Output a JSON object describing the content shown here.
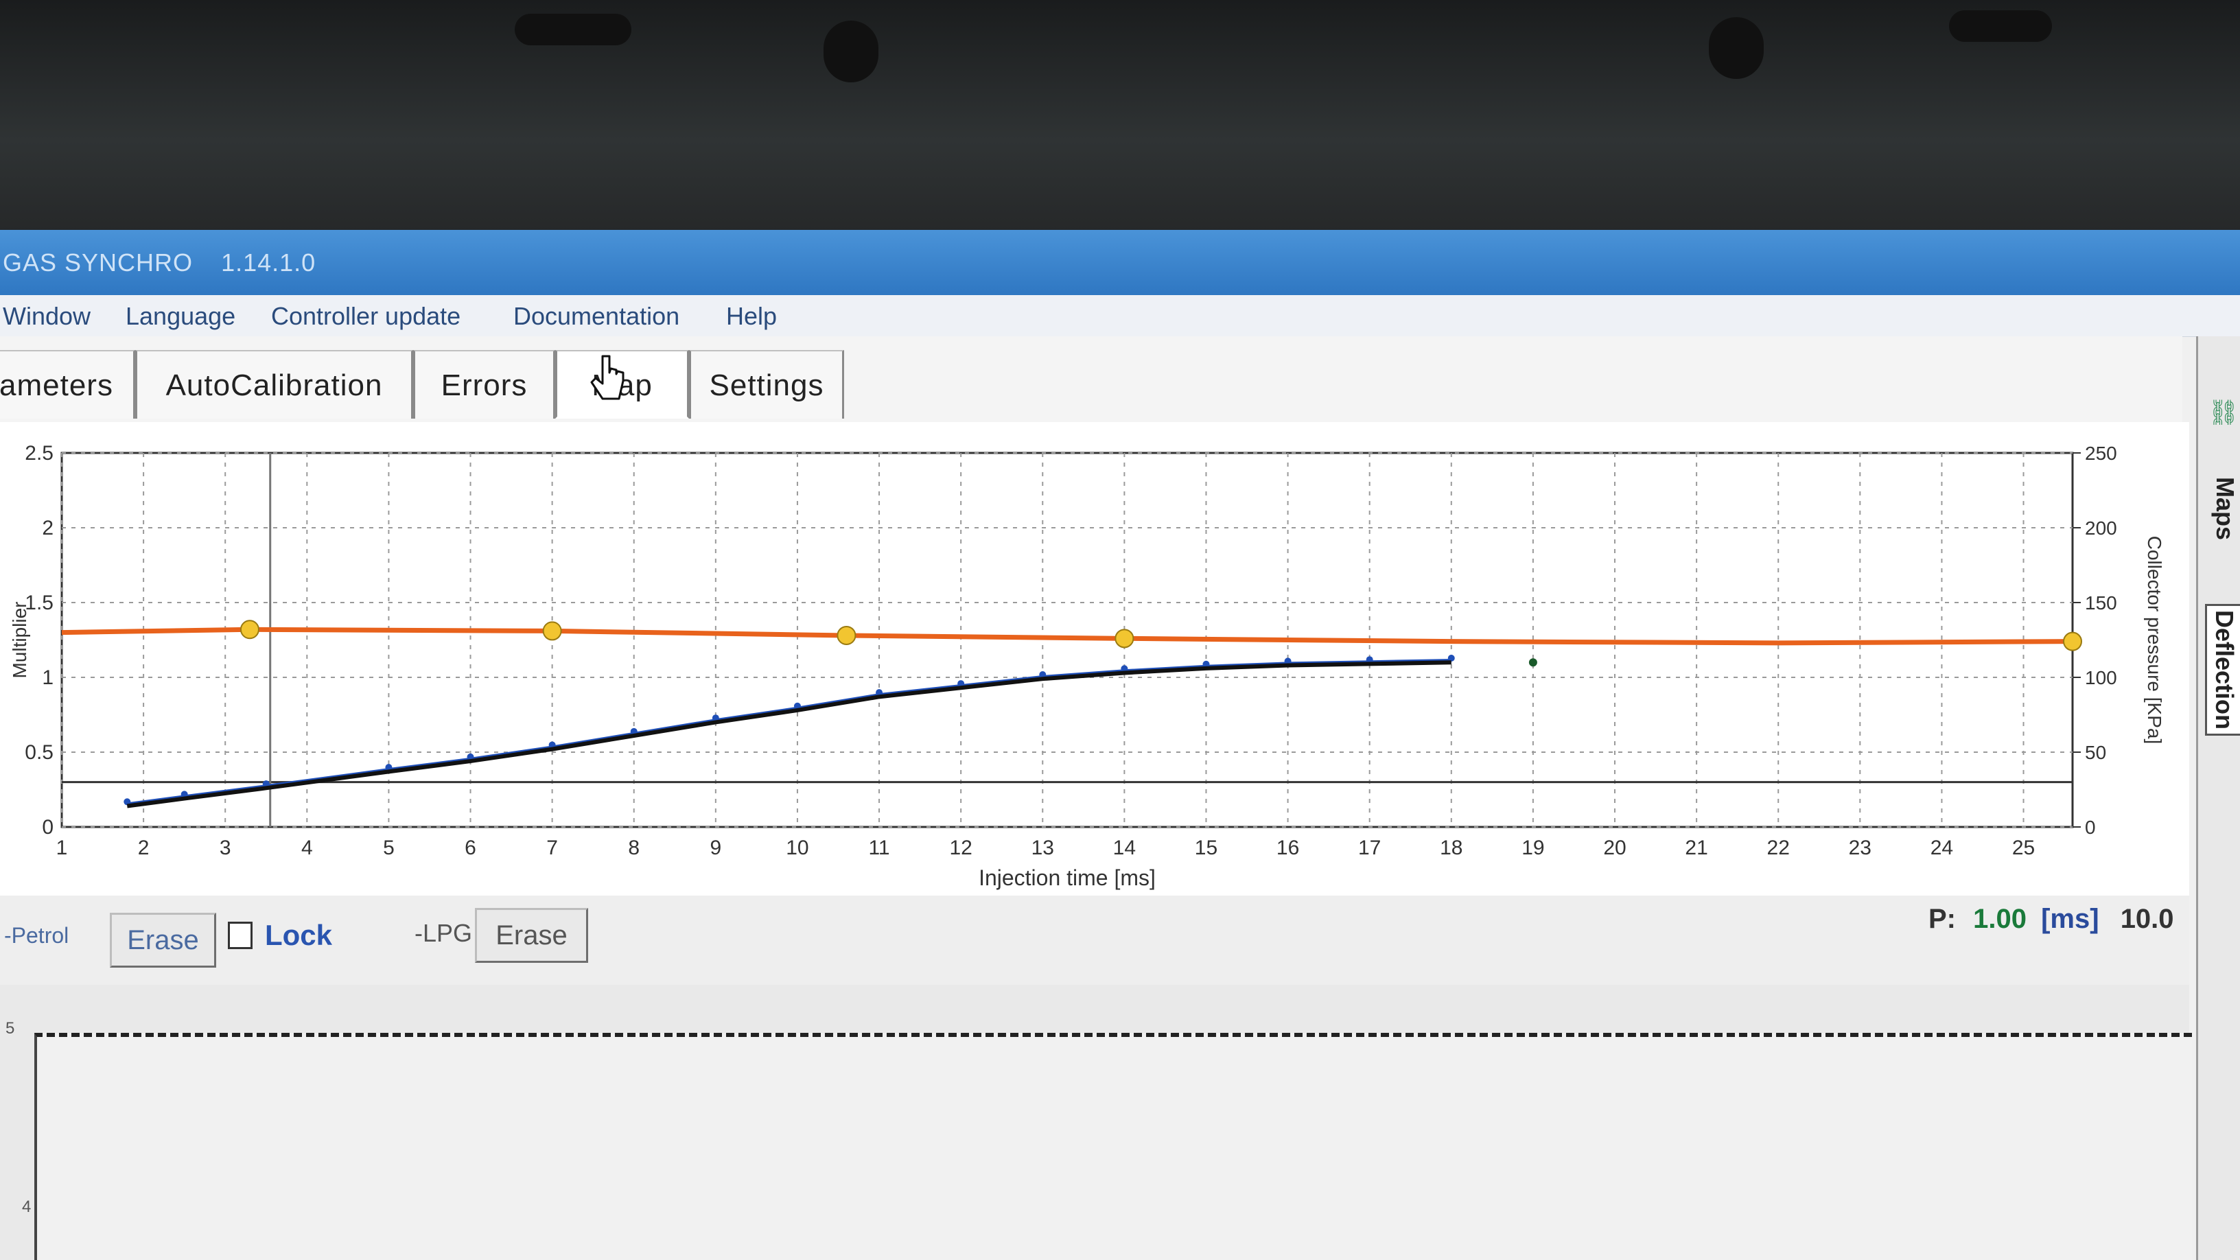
{
  "window": {
    "app_title": "GAS SYNCHRO",
    "version": "1.14.1.0"
  },
  "menu": [
    "Window",
    "Language",
    "Controller update",
    "Documentation",
    "Help"
  ],
  "tabs": [
    {
      "label": "ameters",
      "active": false
    },
    {
      "label": "AutoCalibration",
      "active": false
    },
    {
      "label": "Errors",
      "active": false
    },
    {
      "label": "Map",
      "active": true
    },
    {
      "label": "Settings",
      "active": false
    }
  ],
  "side_tabs": [
    "Maps",
    "Deflection"
  ],
  "chart_data": {
    "type": "line",
    "xlabel": "Injection time [ms]",
    "ylabel_left": "Multiplier",
    "ylabel_right": "Collector pressure [KPa]",
    "xlim": [
      1,
      25.6
    ],
    "ylim_left": [
      0,
      2.5
    ],
    "ylim_right": [
      0,
      250
    ],
    "x_ticks": [
      "1",
      "2",
      "3",
      "4",
      "5",
      "6",
      "7",
      "8",
      "9",
      "10",
      "11",
      "12",
      "13",
      "14",
      "15",
      "16",
      "17",
      "18",
      "19",
      "20",
      "21",
      "22",
      "23",
      "24",
      "25"
    ],
    "y_ticks_left": [
      "0",
      "0.5",
      "1",
      "1.5",
      "2",
      "2.5"
    ],
    "y_ticks_right": [
      "0",
      "50",
      "100",
      "150",
      "200",
      "250"
    ],
    "grid": true,
    "series": [
      {
        "color": "#e8621c",
        "axis": "left",
        "x": [
          1,
          3.3,
          7.0,
          10.6,
          14.0,
          18,
          22,
          25.6
        ],
        "y": [
          1.3,
          1.32,
          1.31,
          1.28,
          1.26,
          1.24,
          1.23,
          1.24
        ],
        "marker_points": [
          [
            3.3,
            1.32
          ],
          [
            7.0,
            1.31
          ],
          [
            10.6,
            1.28
          ],
          [
            14.0,
            1.26
          ],
          [
            25.6,
            1.24
          ]
        ],
        "marker_color": "#f2c530"
      },
      {
        "color": "#1f4fb8",
        "axis": "left",
        "x": [
          1.8,
          2.5,
          3.5,
          5,
          6,
          7,
          8,
          9,
          10,
          11,
          12,
          13,
          14,
          15,
          16,
          17,
          18
        ],
        "y": [
          0.15,
          0.2,
          0.27,
          0.38,
          0.45,
          0.53,
          0.62,
          0.71,
          0.79,
          0.88,
          0.94,
          1.0,
          1.04,
          1.07,
          1.09,
          1.1,
          1.11
        ]
      },
      {
        "color": "#111111",
        "axis": "left",
        "x": [
          1.8,
          2.5,
          3.5,
          5,
          6,
          7,
          8,
          9,
          10,
          11,
          12,
          13,
          14,
          15,
          16,
          17,
          18
        ],
        "y": [
          0.14,
          0.19,
          0.26,
          0.37,
          0.44,
          0.52,
          0.61,
          0.7,
          0.78,
          0.87,
          0.93,
          0.99,
          1.03,
          1.06,
          1.08,
          1.09,
          1.1
        ]
      }
    ],
    "hline_left": 0.3,
    "hline_right": 30,
    "cursor_x": 3.55,
    "extra_point": [
      19.0,
      1.1
    ]
  },
  "controls": {
    "petrol_label": "-Petrol",
    "erase_petrol": "Erase",
    "lock_label": "Lock",
    "lpg_label": "-LPG",
    "erase_lpg": "Erase",
    "p_label": "P:",
    "p_value": "1.00",
    "p_unit": "[ms]",
    "p_extra": "10.0"
  },
  "lower_chart": {
    "y_ticks": [
      "5",
      "4"
    ]
  }
}
